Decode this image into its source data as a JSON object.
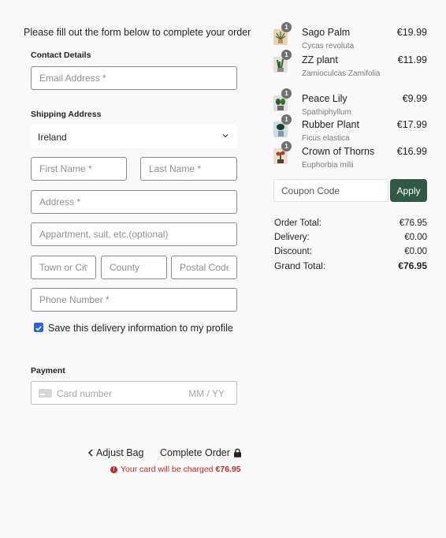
{
  "intro": "Please fill out the form below to complete your order",
  "contact": {
    "title": "Contact Details",
    "email_placeholder": "Email Address *"
  },
  "shipping": {
    "title": "Shipping Address",
    "country": "Ireland",
    "first_name_placeholder": "First Name *",
    "last_name_placeholder": "Last Name *",
    "address_placeholder": "Address *",
    "apartment_placeholder": "Appartment, suit, etc.(optional)",
    "town_placeholder": "Town or City",
    "county_placeholder": "County",
    "postal_placeholder": "Postal Code",
    "phone_placeholder": "Phone Number *",
    "save_label": "Save this delivery information to my profile",
    "save_checked": true
  },
  "payment": {
    "title": "Payment",
    "card_placeholder": "Card number",
    "expiry_placeholder": "MM / YY"
  },
  "actions": {
    "adjust_label": "Adjust Bag",
    "complete_label": "Complete Order",
    "warning_text": "Your card will be charged",
    "warning_amount": "€76.95"
  },
  "cart": {
    "items": [
      {
        "name": "Sago Palm",
        "scientific": "Cycas revoluta",
        "price": "€19.99",
        "qty": "1"
      },
      {
        "name": "ZZ plant",
        "scientific": "Zamioculcas Zamifolia",
        "price": "€11.99",
        "qty": "1"
      },
      {
        "name": "Peace Lily",
        "scientific": "Spathiphyllum",
        "price": "€9.99",
        "qty": "1"
      },
      {
        "name": "Rubber Plant",
        "scientific": "Ficus elastica",
        "price": "€17.99",
        "qty": "1"
      },
      {
        "name": "Crown of Thorns",
        "scientific": "Euphorbia milii",
        "price": "€16.99",
        "qty": "1"
      }
    ],
    "coupon_placeholder": "Coupon Code",
    "apply_label": "Apply"
  },
  "totals": {
    "order_total_label": "Order Total:",
    "order_total": "€76.95",
    "delivery_label": "Delivery:",
    "delivery": "€0.00",
    "discount_label": "Discount:",
    "discount": "€0.00",
    "grand_total_label": "Grand Total:",
    "grand_total": "€76.95"
  },
  "colors": {
    "accent": "#2f5846",
    "checkbox": "#2a66d9",
    "error": "#c62828"
  }
}
